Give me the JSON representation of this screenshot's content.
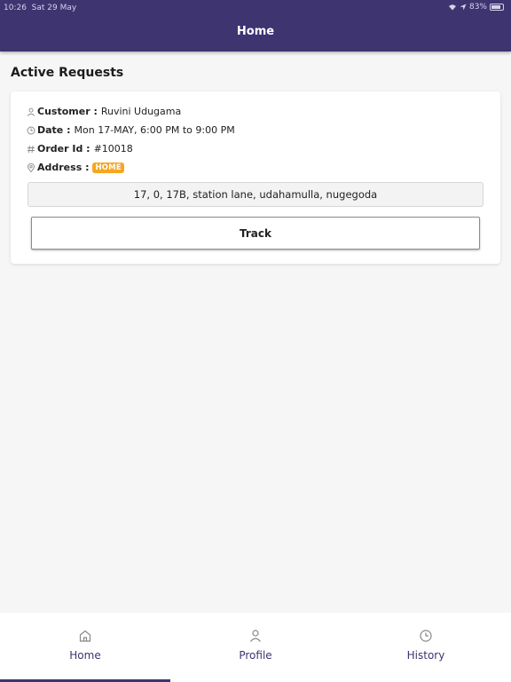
{
  "status_bar": {
    "time": "10:26",
    "date": "Sat 29 May",
    "battery": "83%",
    "battery_level": 0.83
  },
  "header": {
    "title": "Home"
  },
  "section": {
    "title": "Active Requests"
  },
  "request": {
    "customer_label": "Customer :",
    "customer_value": "Ruvini Udugama",
    "date_label": "Date :",
    "date_value": "Mon 17-MAY, 6:00 PM to 9:00 PM",
    "order_label": "Order Id :",
    "order_value": "#10018",
    "address_label": "Address :",
    "address_badge": "HOME",
    "address_text": "17, 0, 17B, station lane, udahamulla, nugegoda",
    "track_label": "Track"
  },
  "nav": {
    "home": "Home",
    "profile": "Profile",
    "history": "History"
  },
  "colors": {
    "primary": "#3d3470",
    "badge": "#f5a623"
  }
}
